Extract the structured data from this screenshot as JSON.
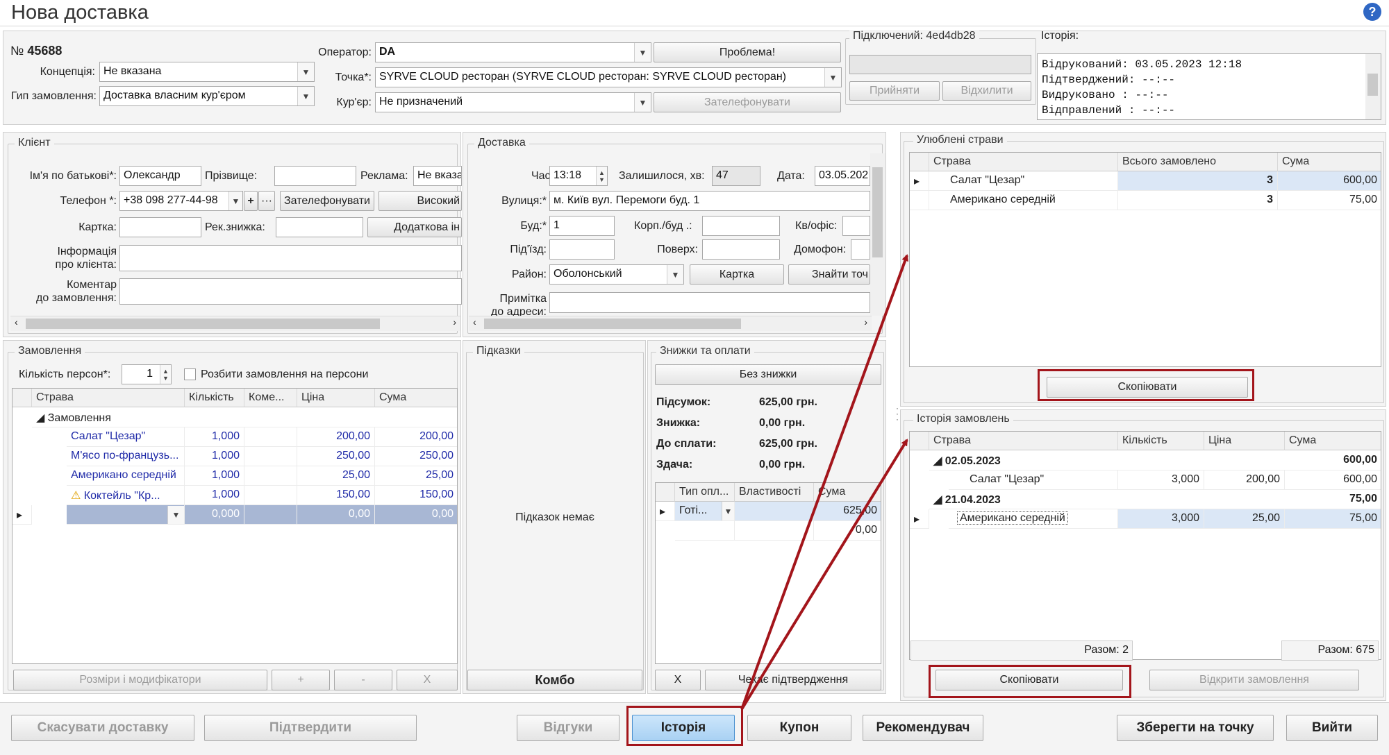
{
  "window": {
    "title": "Нова доставка",
    "help_icon": "?"
  },
  "header": {
    "number_prefix": "№",
    "number": "45688",
    "concept_label": "Концепція:",
    "concept_value": "Не вказана",
    "order_type_label": "Гип замовлення:",
    "order_type_value": "Доставка власним кур'єром",
    "operator_label": "Оператор:",
    "operator_value": "DA",
    "problem_btn": "Проблема!",
    "point_label": "Точка*:",
    "point_value": "SYRVE CLOUD ресторан (SYRVE CLOUD ресторан: SYRVE CLOUD ресторан)",
    "courier_label": "Кур'єр:",
    "courier_value": "Не призначений",
    "call_btn": "Зателефонувати",
    "connected_label": "Підключений: 4ed4db28",
    "accept_btn": "Прийняти",
    "reject_btn": "Відхилити",
    "history_label": "Історія:",
    "history_lines": [
      "Відрукований: 03.05.2023 12:18",
      "Підтверджений: --:--",
      "Видруковано   : --:--",
      "Відправлений   : --:--"
    ]
  },
  "client": {
    "title": "Клієнт",
    "first_name_label": "Ім'я по батькові*:",
    "first_name": "Олександр",
    "last_name_label": "Прізвище:",
    "last_name": "",
    "ad_label": "Реклама:",
    "ad_value": "Не вказа",
    "phone_label": "Телефон *:",
    "phone": "+38 098 277-44-98",
    "plus": "+",
    "dots": "···",
    "call_btn": "Зателефонувати",
    "high_btn": "Високий",
    "card_label": "Картка:",
    "card": "",
    "rec_discount_label": "Рек.знижка:",
    "rec_discount": "",
    "extra_btn": "Додаткова ін",
    "info_label_1": "Інформація",
    "info_label_2": "про клієнта:",
    "comment_label_1": "Коментар",
    "comment_label_2": "до замовлення:"
  },
  "delivery": {
    "title": "Доставка",
    "time_label": "Час:",
    "time": "13:18",
    "remain_label": "Залишилося, хв:",
    "remain": "47",
    "date_label": "Дата:",
    "date": "03.05.202",
    "street_label": "Вулиця:*",
    "street": "м. Київ вул. Перемоги буд. 1",
    "house_label": "Буд:*",
    "house": "1",
    "corp_label": "Корп./буд .:",
    "corp": "",
    "apt_label": "Кв/офіс:",
    "entrance_label": "Під'їзд:",
    "floor_label": "Поверх:",
    "intercom_label": "Домофон:",
    "district_label": "Район:",
    "district": "Оболонський",
    "map_btn": "Картка",
    "find_btn": "Знайти точ",
    "note_label_1": "Примітка",
    "note_label_2": "до адреси:"
  },
  "favorites": {
    "title": "Улюблені страви",
    "cols": [
      "Страва",
      "Всього замовлено",
      "Сума"
    ],
    "rows": [
      {
        "dish": "Салат \"Цезар\"",
        "count": "3",
        "sum": "600,00"
      },
      {
        "dish": "Американо середній",
        "count": "3",
        "sum": "75,00"
      }
    ],
    "copy_btn": "Скопіювати"
  },
  "order": {
    "title": "Замовлення",
    "persons_label": "Кількість персон*:",
    "persons": "1",
    "split_label": "Розбити замовлення на персони",
    "cols": [
      "Страва",
      "Кількість",
      "Коме...",
      "Ціна",
      "Сума"
    ],
    "group": "Замовлення",
    "rows": [
      {
        "dish": "Салат \"Цезар\"",
        "qty": "1,000",
        "price": "200,00",
        "sum": "200,00"
      },
      {
        "dish": "М'ясо по-французь...",
        "qty": "1,000",
        "price": "250,00",
        "sum": "250,00"
      },
      {
        "dish": "Американо середній",
        "qty": "1,000",
        "price": "25,00",
        "sum": "25,00"
      },
      {
        "dish": "Коктейль \"Кр...",
        "qty": "1,000",
        "price": "150,00",
        "sum": "150,00"
      }
    ],
    "empty_row": {
      "qty": "0,000",
      "price": "0,00",
      "sum": "0,00"
    },
    "sizes_btn": "Розміри і модифікатори",
    "plus_btn": "+",
    "minus_btn": "-",
    "x_btn": "X"
  },
  "hints": {
    "title": "Підказки",
    "empty": "Підказок немає",
    "combo_btn": "Комбо"
  },
  "payments": {
    "title": "Знижки та оплати",
    "no_discount_btn": "Без знижки",
    "subtotal_label": "Підсумок:",
    "subtotal": "625,00 грн.",
    "discount_label": "Знижка:",
    "discount": "0,00 грн.",
    "to_pay_label": "До сплати:",
    "to_pay": "625,00 грн.",
    "change_label": "Здача:",
    "change": "0,00 грн.",
    "cols": [
      "Тип опл...",
      "Властивості",
      "Сума"
    ],
    "rows": [
      {
        "type": "Готі...",
        "sum": "625,00"
      },
      {
        "type": "",
        "sum": "0,00"
      }
    ],
    "x_btn": "X",
    "check_btn": "Чекає підтвердження"
  },
  "history": {
    "title": "Історія замовлень",
    "cols": [
      "Страва",
      "Кількість",
      "Ціна",
      "Сума"
    ],
    "groups": [
      {
        "date": "02.05.2023",
        "total": "600,00",
        "items": [
          {
            "dish": "Салат \"Цезар\"",
            "qty": "3,000",
            "price": "200,00",
            "sum": "600,00"
          }
        ]
      },
      {
        "date": "21.04.2023",
        "total": "75,00",
        "items": [
          {
            "dish": "Американо середній",
            "qty": "3,000",
            "price": "25,00",
            "sum": "75,00"
          }
        ]
      }
    ],
    "count_total": "Разом: 2",
    "sum_total": "Разом: 675",
    "copy_btn": "Скопіювати",
    "open_btn": "Відкрити замовлення"
  },
  "footer": {
    "cancel_btn": "Скасувати доставку",
    "confirm_btn": "Підтвердити",
    "reviews_btn": "Відгуки",
    "history_btn": "Історія",
    "coupon_btn": "Купон",
    "recommender_btn": "Рекомендувач",
    "save_btn": "Зберегти на точку",
    "exit_btn": "Вийти"
  },
  "colors": {
    "annotation_red": "#a3151b",
    "selection": "#dbe7f6",
    "dish_blue": "#1f2aa8"
  }
}
